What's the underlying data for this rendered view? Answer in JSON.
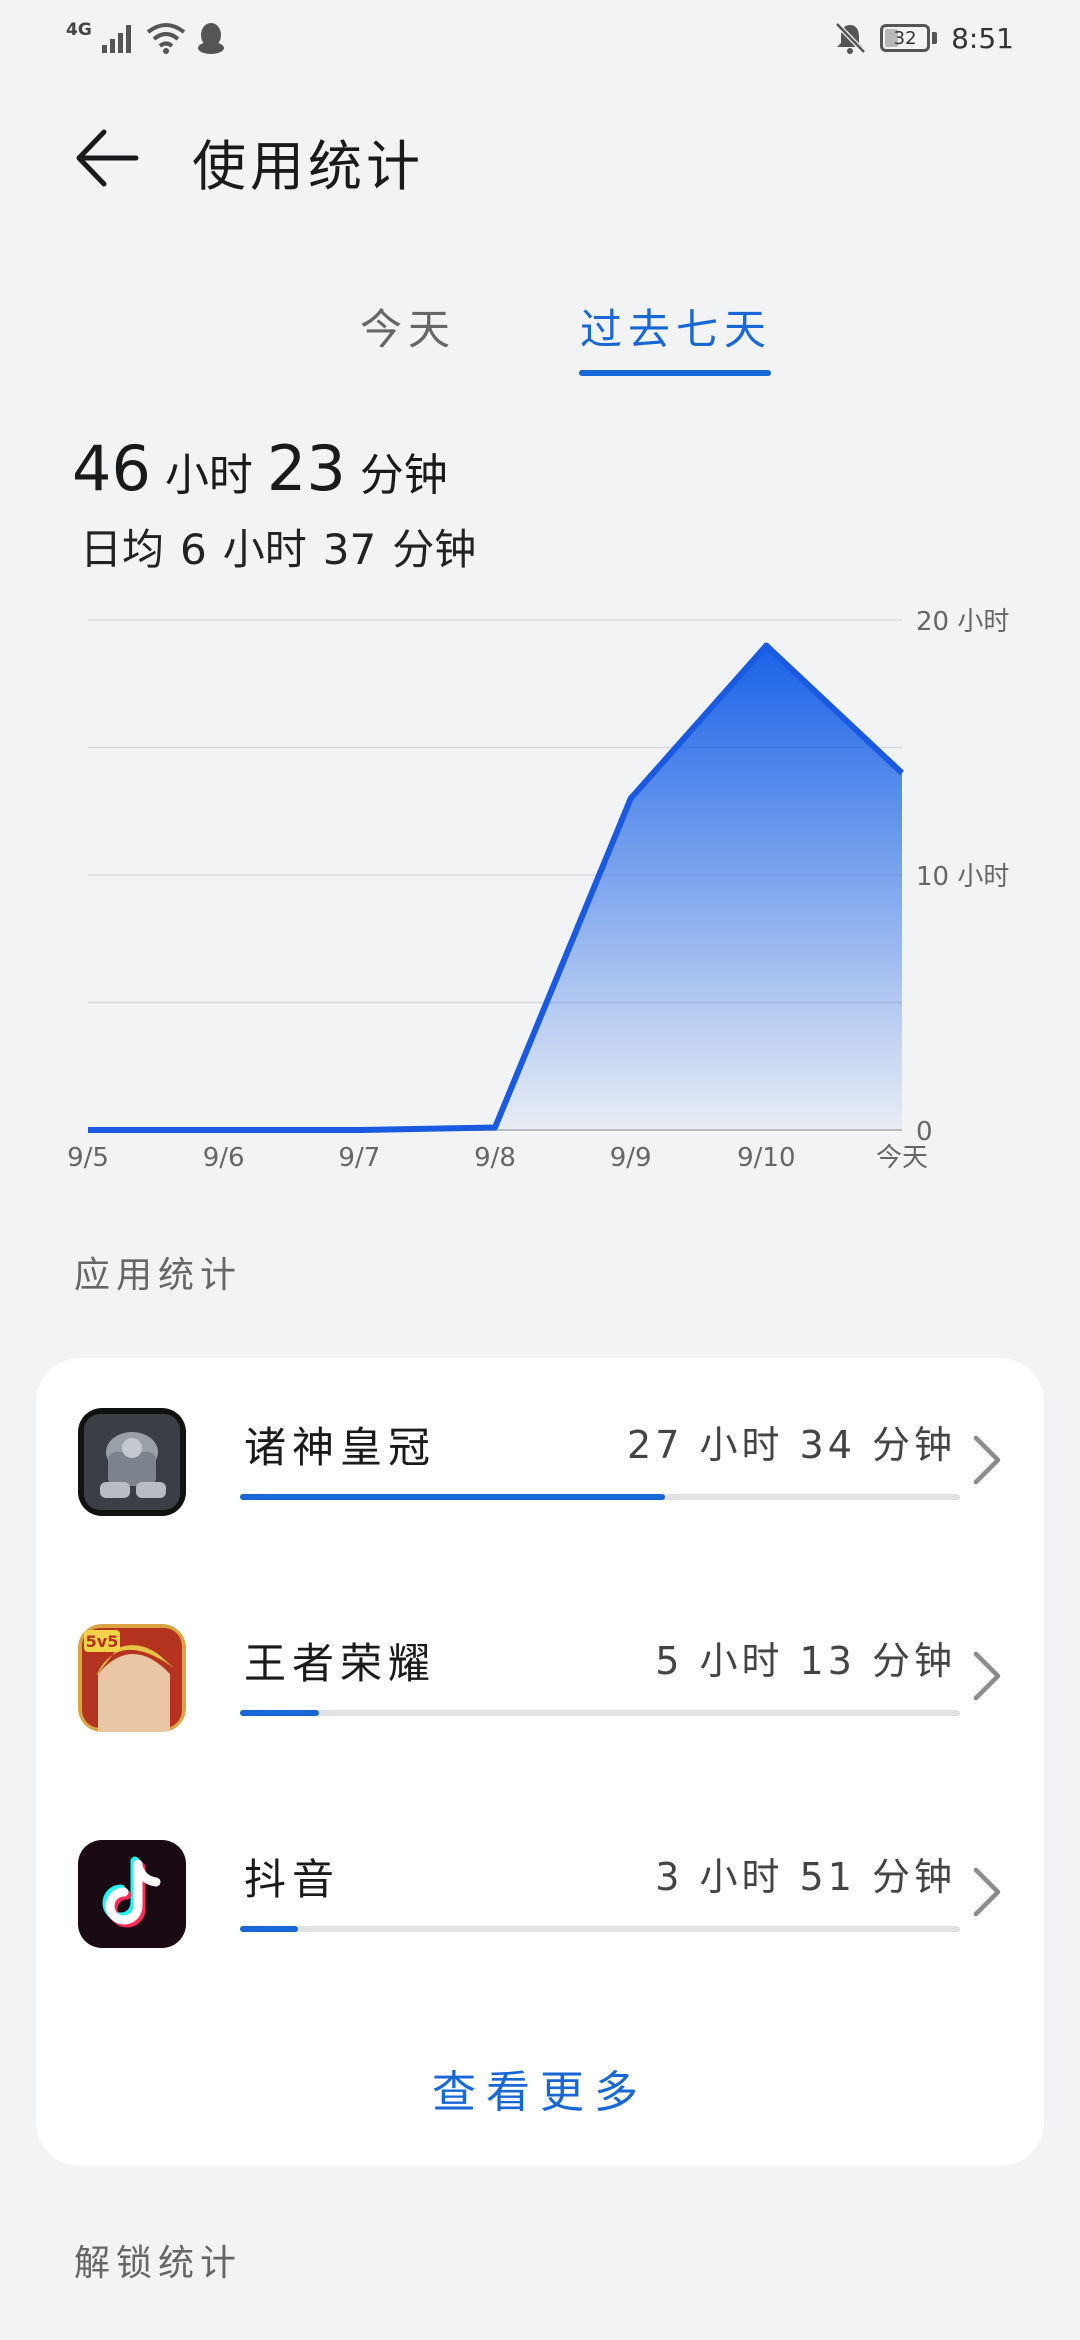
{
  "status_bar": {
    "network": "4G",
    "battery": "32",
    "time": "8:51"
  },
  "header": {
    "title": "使用统计"
  },
  "tabs": {
    "today": "今天",
    "past_week": "过去七天",
    "active": "过去七天"
  },
  "summary": {
    "total_hours": "46",
    "total_minutes": "23",
    "hours_unit": "小时",
    "minutes_unit": "分钟",
    "avg_prefix": "日均",
    "avg_hours": "6",
    "avg_minutes": "37"
  },
  "chart_data": {
    "type": "area",
    "categories": [
      "9/5",
      "9/6",
      "9/7",
      "9/8",
      "9/9",
      "9/10",
      "今天"
    ],
    "values": [
      0,
      0,
      0,
      0.1,
      13,
      19,
      14
    ],
    "y_ticks": [
      "0",
      "10 小时",
      "20 小时"
    ],
    "ylim": [
      0,
      20
    ],
    "grid": true,
    "color": "#1a62e8"
  },
  "app_stats": {
    "title": "应用统计",
    "apps": [
      {
        "name": "诸神皇冠",
        "time": "27 小时 34 分钟",
        "share": 0.59
      },
      {
        "name": "王者荣耀",
        "time": "5 小时 13 分钟",
        "share": 0.11
      },
      {
        "name": "抖音",
        "time": "3 小时 51 分钟",
        "share": 0.08
      }
    ],
    "view_more": "查看更多"
  },
  "unlock_stats": {
    "title": "解锁统计"
  },
  "colors": {
    "accent": "#1767d6",
    "background": "#f1f3f5",
    "card": "#ffffff"
  }
}
